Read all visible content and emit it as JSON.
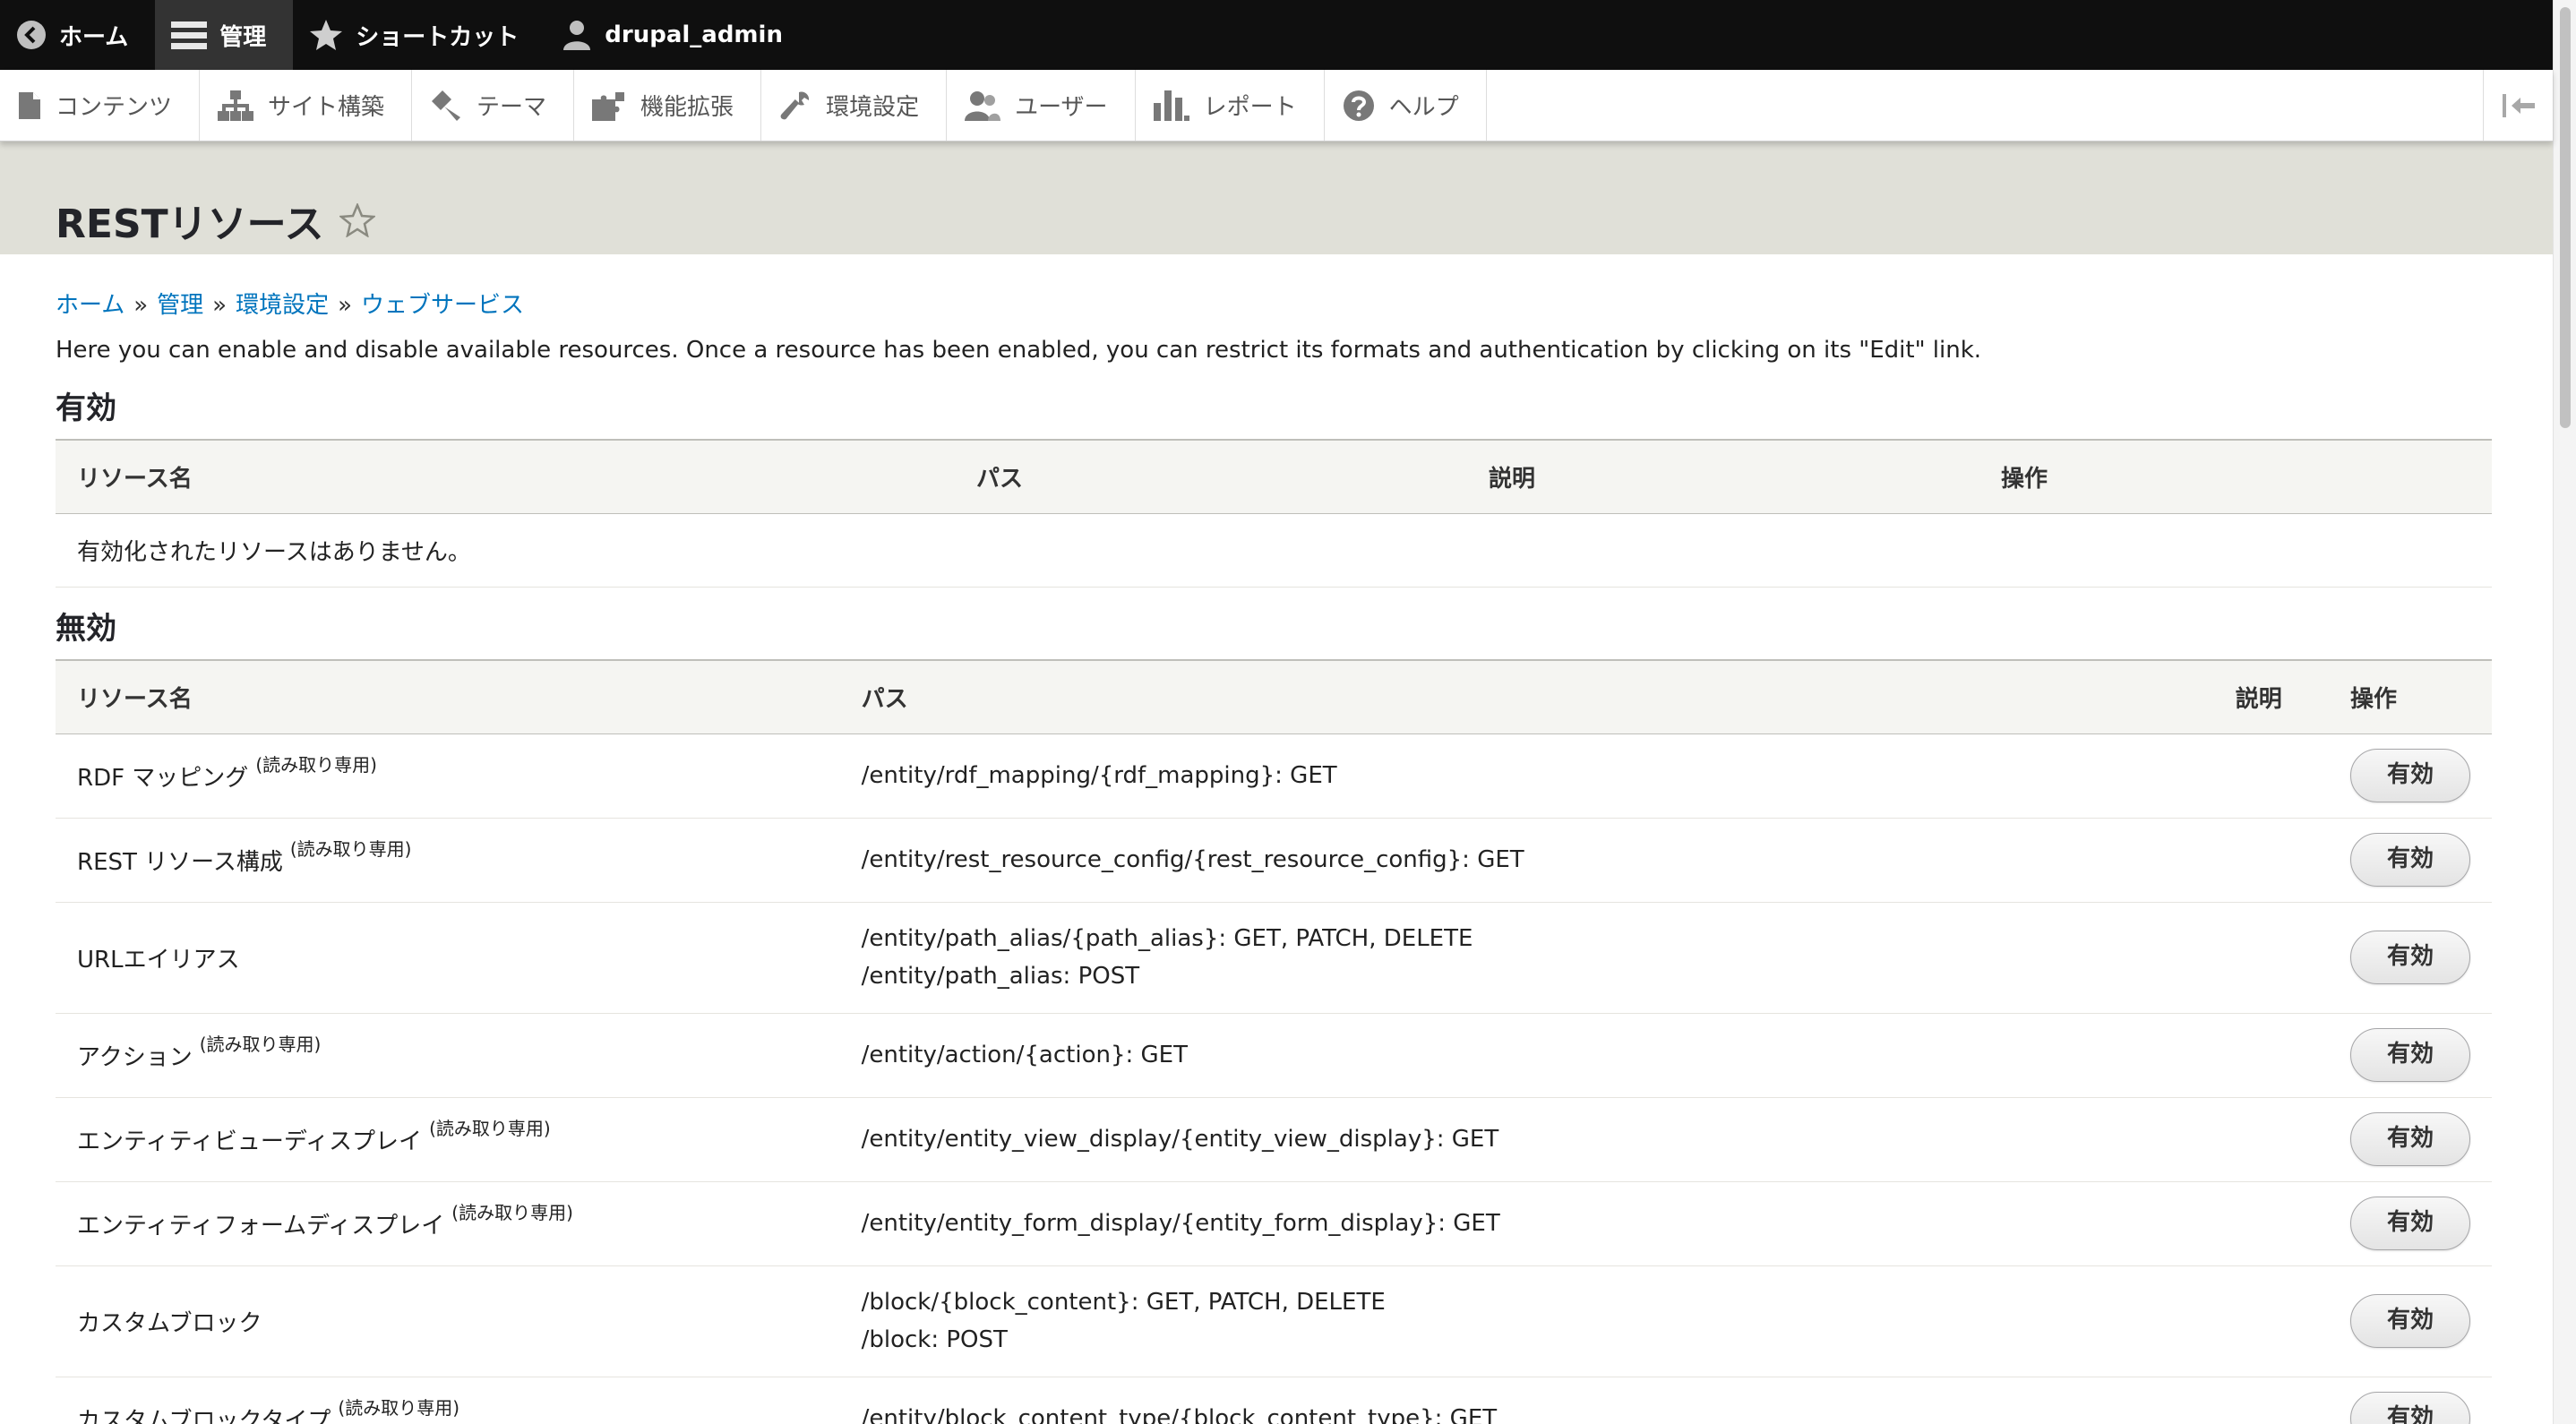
{
  "toolbar": {
    "home_label": "ホーム",
    "manage_label": "管理",
    "shortcuts_label": "ショートカット",
    "user_label": "drupal_admin"
  },
  "tray": {
    "items": [
      {
        "label": "コンテンツ",
        "icon": "file-icon"
      },
      {
        "label": "サイト構築",
        "icon": "sitemap-icon"
      },
      {
        "label": "テーマ",
        "icon": "paintbrush-icon"
      },
      {
        "label": "機能拡張",
        "icon": "puzzle-icon"
      },
      {
        "label": "環境設定",
        "icon": "wrench-icon"
      },
      {
        "label": "ユーザー",
        "icon": "people-icon"
      },
      {
        "label": "レポート",
        "icon": "bar-chart-icon"
      },
      {
        "label": "ヘルプ",
        "icon": "help-icon"
      }
    ]
  },
  "page": {
    "title": "RESTリソース",
    "breadcrumb": [
      "ホーム",
      "管理",
      "環境設定",
      "ウェブサービス"
    ],
    "breadcrumb_separator": "»",
    "description": "Here you can enable and disable available resources. Once a resource has been enabled, you can restrict its formats and authentication by clicking on its \"Edit\" link."
  },
  "enabled": {
    "heading": "有効",
    "columns": [
      "リソース名",
      "パス",
      "説明",
      "操作"
    ],
    "empty_message": "有効化されたリソースはありません。"
  },
  "disabled": {
    "heading": "無効",
    "columns": [
      "リソース名",
      "パス",
      "説明",
      "操作"
    ],
    "read_only_label": "(読み取り専用)",
    "button_label": "有効",
    "rows": [
      {
        "name": "RDF マッピング",
        "read_only": "(読み取り専用)",
        "paths": [
          "/entity/rdf_mapping/{rdf_mapping}: GET"
        ]
      },
      {
        "name": "REST リソース構成",
        "read_only": "(読み取り専用)",
        "paths": [
          "/entity/rest_resource_config/{rest_resource_config}: GET"
        ]
      },
      {
        "name": "URLエイリアス",
        "read_only": "",
        "paths": [
          "/entity/path_alias/{path_alias}: GET, PATCH, DELETE",
          "/entity/path_alias: POST"
        ]
      },
      {
        "name": "アクション",
        "read_only": "(読み取り専用)",
        "paths": [
          "/entity/action/{action}: GET"
        ]
      },
      {
        "name": "エンティティビューディスプレイ",
        "read_only": "(読み取り専用)",
        "paths": [
          "/entity/entity_view_display/{entity_view_display}: GET"
        ]
      },
      {
        "name": "エンティティフォームディスプレイ",
        "read_only": "(読み取り専用)",
        "paths": [
          "/entity/entity_form_display/{entity_form_display}: GET"
        ]
      },
      {
        "name": "カスタムブロック",
        "read_only": "",
        "paths": [
          "/block/{block_content}: GET, PATCH, DELETE",
          "/block: POST"
        ]
      },
      {
        "name": "カスタムブロックタイプ",
        "read_only": "(読み取り専用)",
        "paths": [
          "/entity/block_content_type/{block_content_type}: GET"
        ]
      }
    ]
  }
}
